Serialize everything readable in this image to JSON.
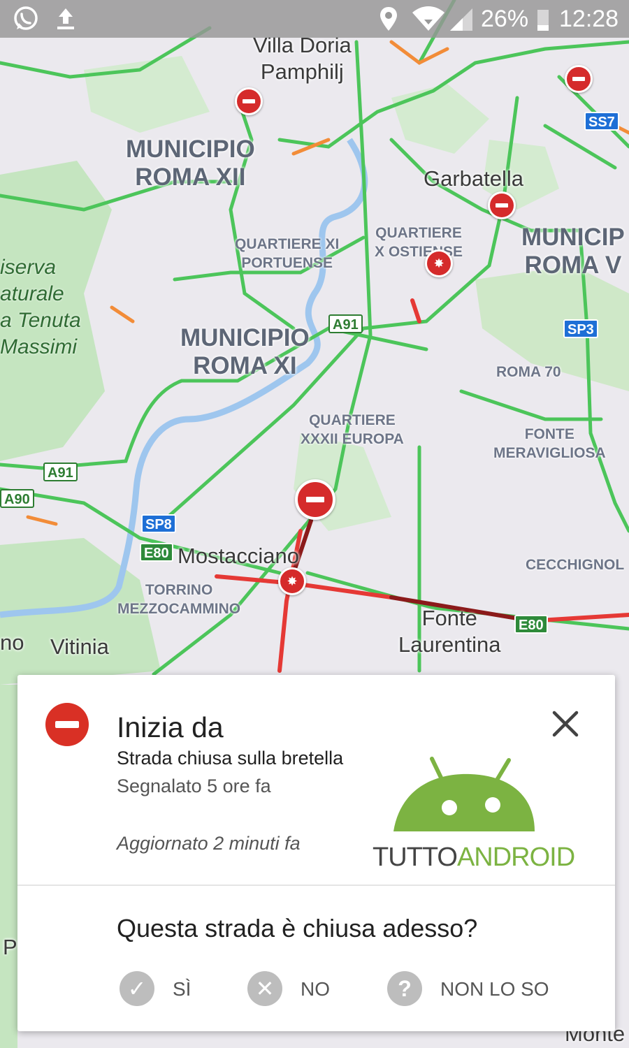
{
  "status_bar": {
    "icons": [
      "whatsapp-icon",
      "upload-icon",
      "location-icon",
      "wifi-icon",
      "signal-icon",
      "battery-icon"
    ],
    "battery": "26%",
    "time": "12:28"
  },
  "map": {
    "places": {
      "villa_doria": "Villa Doria\nPamphilj",
      "garbatella": "Garbatella",
      "mostacciano": "Mostacciano",
      "fonte_laurentina": "Fonte\nLaurentina",
      "vitinia": "Vitinia",
      "no_partial": "no",
      "monte_partial": "Monte",
      "p_partial": "P"
    },
    "municipi": {
      "roma_xii": "MUNICIPIO\nROMA XII",
      "roma_xi": "MUNICIPIO\nROMA XI",
      "roma_v": "MUNICIP\nROMA V"
    },
    "quarters": {
      "portuense": "QUARTIERE XI\nPORTUENSE",
      "ostiense": "QUARTIERE\nX OSTIENSE",
      "europa": "QUARTIERE\nXXXII EUROPA",
      "roma70": "ROMA 70",
      "meravigliosa": "FONTE\nMERAVIGLIOSA",
      "torrino": "TORRINO\nMEZZOCAMMINO",
      "cecchignola": "CECCHIGNOL"
    },
    "park": "iserva\naturale\na Tenuta\nMassimi",
    "shields": {
      "ss7": "SS7",
      "sp3": "SP3",
      "a91_top": "A91",
      "a91_left": "A91",
      "a90": "A90",
      "sp8": "SP8",
      "e80_left": "E80",
      "e80_right": "E80"
    },
    "colors": {
      "free_flow": "#4cc55a",
      "slow": "#f28c38",
      "jam": "#e53935",
      "heavy_jam": "#8b1a1a",
      "river": "#9ec6ee",
      "park": "#c5e5c0"
    }
  },
  "card": {
    "title": "Inizia da",
    "subtitle": "Strada chiusa sulla bretella",
    "reported": "Segnalato 5 ore fa",
    "updated": "Aggiornato 2 minuti fa",
    "question": "Questa strada è chiusa adesso?",
    "answers": [
      {
        "icon": "check-icon",
        "label": "SÌ"
      },
      {
        "icon": "x-icon",
        "label": "NO"
      },
      {
        "icon": "question-icon",
        "label": "NON LO SO"
      }
    ],
    "watermark_part1": "TUTTO",
    "watermark_part2": "ANDROID",
    "close_icon": "close-icon",
    "closure_icon": "road-closed-icon"
  }
}
